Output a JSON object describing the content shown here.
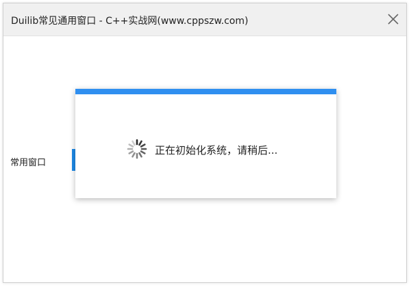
{
  "window": {
    "title": "Duilib常见通用窗口 - C++实战网(www.cppszw.com)",
    "close_icon": "close-icon"
  },
  "main": {
    "side_label": "常用窗口"
  },
  "loading": {
    "text": "正在初始化系统，请稍后...",
    "spinner_icon": "spinner-icon"
  },
  "colors": {
    "accent": "#2f8ff0",
    "titlebar_bg": "#f0f0f0"
  }
}
